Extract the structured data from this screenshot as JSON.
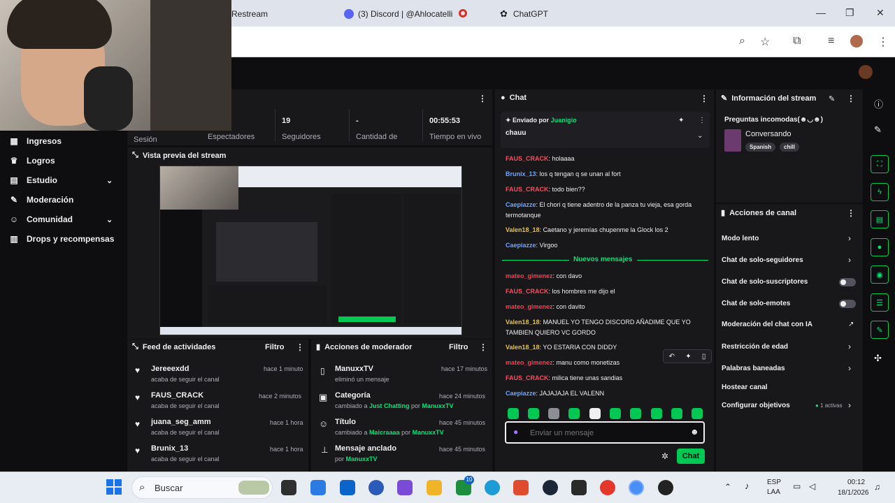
{
  "browser": {
    "tabs": [
      {
        "title": "Restream"
      },
      {
        "title": "(3) Discord | @Ahlocatelli"
      },
      {
        "title": "ChatGPT"
      }
    ]
  },
  "sidebar": {
    "items": [
      {
        "label": "Ingresos",
        "icon": "dollar-icon"
      },
      {
        "label": "Logros",
        "icon": "trophy-icon"
      },
      {
        "label": "Estudio",
        "icon": "studio-icon"
      },
      {
        "label": "Moderación",
        "icon": "wrench-icon"
      },
      {
        "label": "Comunidad",
        "icon": "people-icon"
      },
      {
        "label": "Drops y recompensas",
        "icon": "gift-icon"
      }
    ]
  },
  "stats": [
    {
      "value": "",
      "label": "Sesión"
    },
    {
      "value": "",
      "label": "Espectadores"
    },
    {
      "value": "19",
      "label": "Seguidores"
    },
    {
      "value": "-",
      "label": "Cantidad de"
    },
    {
      "value": "00:55:53",
      "label": "Tiempo en vivo"
    }
  ],
  "preview": {
    "title": "Vista previa del stream"
  },
  "feed": {
    "title": "Feed de actividades",
    "filter": "Filtro",
    "items": [
      {
        "name": "Jereeexdd",
        "action": "acaba de seguir el canal",
        "time": "hace 1 minuto"
      },
      {
        "name": "FAUS_CRACK",
        "action": "acaba de seguir el canal",
        "time": "hace 2 minutos"
      },
      {
        "name": "juana_seg_amm",
        "action": "acaba de seguir el canal",
        "time": "hace 1 hora"
      },
      {
        "name": "Brunix_13",
        "action": "acaba de seguir el canal",
        "time": "hace 1 hora"
      }
    ]
  },
  "modactions": {
    "title": "Acciones de moderador",
    "filter": "Filtro",
    "items": [
      {
        "name": "ManuxxTV",
        "line1": "eliminó un mensaje",
        "time": "hace 17 minutos"
      },
      {
        "name": "Categoría",
        "pre": "cambiado a ",
        "hl": "Just Chatting",
        "mid": " por ",
        "by": "ManuxxTV",
        "time": "hace 24 minutos"
      },
      {
        "name": "Título",
        "pre": "cambiado a ",
        "hl": "Maicraaaa",
        "mid": " por ",
        "by": "ManuxxTV",
        "time": "hace 45 minutos"
      },
      {
        "name": "Mensaje anclado",
        "pre": "por ",
        "by": "ManuxxTV",
        "time": "hace 45 minutos"
      }
    ]
  },
  "chat": {
    "title": "Chat",
    "pinned": {
      "sentby_label": "Enviado por",
      "sentby": "Juanigio",
      "text": "chauu"
    },
    "messages": [
      {
        "user": "FAUS_CRACK",
        "color": "red",
        "text": "holaaaa"
      },
      {
        "user": "Brunix_13",
        "color": "blue",
        "text": "los q tengan q se unan al fort"
      },
      {
        "user": "FAUS_CRACK",
        "color": "red",
        "text": "todo bien??"
      },
      {
        "user": "Caepiazze",
        "color": "blue",
        "text": "El chori q tiene adentro de la panza tu vieja, esa gorda termotanque"
      },
      {
        "user": "Valen18_18",
        "color": "yellow",
        "text": "Caetano y jeremías chupenme la Glock los 2"
      },
      {
        "user": "Caepiazze",
        "color": "blue",
        "text": "Virgoo"
      }
    ],
    "new_label": "Nuevos mensajes",
    "new_messages": [
      {
        "user": "mateo_gimenez",
        "color": "redblur",
        "text": "con davo"
      },
      {
        "user": "FAUS_CRACK",
        "color": "red",
        "text": "los hombres me dijo el"
      },
      {
        "user": "mateo_gimenez",
        "color": "redblur",
        "text": "con davito"
      },
      {
        "user": "Valen18_18",
        "color": "yellow",
        "text": "MANUEL YO TENGO DISCORD AÑADIME QUE YO TAMBIEN QUIERO VC GORDO"
      },
      {
        "user": "Valen18_18",
        "color": "yellow",
        "text": "YO ESTARIA CON DIDDY"
      },
      {
        "user": "mateo_gimenez",
        "color": "redblur",
        "text": "manu como monetizas"
      },
      {
        "user": "FAUS_CRACK",
        "color": "red",
        "text": "milica tiene unas sandias"
      },
      {
        "user": "Caepiazze",
        "color": "blue",
        "text": "JAJAJAJA EL VALENN"
      }
    ],
    "input_placeholder": "Enviar un mensaje",
    "send_label": "Chat"
  },
  "info": {
    "title": "Información del stream",
    "stream_title": "Preguntas incomodas(☻◡☻)",
    "category": "Conversando",
    "tags": [
      "Spanish",
      "chill"
    ]
  },
  "actions": {
    "title": "Acciones de canal",
    "items": [
      {
        "label": "Modo lento",
        "kind": "chevron"
      },
      {
        "label": "Chat de solo-seguidores",
        "kind": "chevron"
      },
      {
        "label": "Chat de solo-suscriptores",
        "kind": "toggle"
      },
      {
        "label": "Chat de solo-emotes",
        "kind": "toggle"
      },
      {
        "label": "Moderación del chat con IA",
        "kind": "external"
      },
      {
        "label": "Restricción de edad",
        "kind": "chevron"
      },
      {
        "label": "Palabras baneadas",
        "kind": "chevron"
      },
      {
        "label": "Hostear canal",
        "kind": "none"
      },
      {
        "label": "Configurar objetivos",
        "kind": "chevron"
      }
    ],
    "goals_active": "1 activas"
  },
  "taskbar": {
    "search_label": "Buscar",
    "lang1": "ESP",
    "lang2": "LAA",
    "time": "00:12",
    "date": "18/1/2026",
    "badge": "10"
  }
}
